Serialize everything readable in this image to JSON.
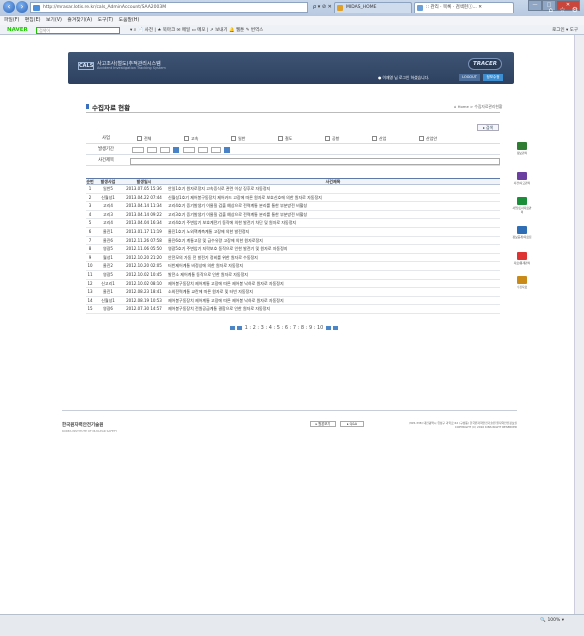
{
  "browser": {
    "url": "http://mrasar.lotis.re.kr/cals_AdminAccount/SAA2003M",
    "address_controls": "ρ ▾ ⊘ ✕",
    "tabs": [
      {
        "label": "MIDAS_HOME",
        "color": "#e0a12a"
      },
      {
        "label": ":: 관리 · 목록 · 검색현ⓘ... ✕",
        "color": "#6a9fd8"
      }
    ],
    "window_buttons": [
      "—",
      "□",
      "✕"
    ],
    "right_icons": "⌂ ☆ ⚙",
    "menu": [
      "파일(F)",
      "편집(E)",
      "보기(V)",
      "즐겨찾기(A)",
      "도구(T)",
      "도움말(H)"
    ],
    "naver_logo": "NAVER",
    "naver_search_placeholder": "검색어",
    "naver_tools": "▾  ⌕  📄 사전  |  ★ 북마크  ✉ 메일  ▭ 메모  |  ↗ 보내기  🔔 웹툰  ✎ 번역스",
    "naver_right": "로그인 ▾   도구",
    "zoom": "🔍 100%  ▾"
  },
  "header": {
    "logo": "CALS",
    "system_name": "사고조사(철도)추적관리시스템",
    "system_name_en": "Accident Investigation Tracking System",
    "brand": "TRACER",
    "welcome": "● 이재영 님 로그인 하셨습니다.",
    "logout": "LOGOUT",
    "myinfo": "정보수정"
  },
  "page": {
    "title": "수집자료 현황",
    "breadcrumb": "⌂ Home > 수집자료관리현황",
    "search_button": "▸ 검색"
  },
  "filters": {
    "category_label": "사업",
    "options": [
      "전체",
      "고속",
      "일반",
      "철도",
      "공항",
      "산업",
      "산업안"
    ],
    "period_label": "발생기간",
    "title_label": "사건제목"
  },
  "table": {
    "headers": [
      "순번",
      "발생사업",
      "발생일시",
      "사건제목"
    ],
    "rows": [
      [
        "1",
        "일반5",
        "2013.07.05 15:36",
        "안일1호기 원자로정지 고속증식로 관련 이상 징후로 자동정지"
      ],
      [
        "2",
        "신월성1",
        "2013.04.22 07:44",
        "신월성1호기 제어봉구동장치 제어카드 고장에 따른 원자로 보호신호에 의한 원자로 자동정지"
      ],
      [
        "3",
        "고리4",
        "2013.04.14 11:34",
        "고리4호기 증기발생기 이물질 검출 예상으로 전력계통 분리를 통한 부분방전 비활성"
      ],
      [
        "4",
        "고리3",
        "2013.04.14 09:22",
        "고리3호기 증기발생기 이물질 검출 예상으로 전력계통 분리를 통한 부분방전 비활성"
      ],
      [
        "5",
        "고리4",
        "2013.04.04 16:34",
        "고리4호기 주변압기 보호계전기 동작에 의한 발전기 차단 및 원자로 자동정지"
      ],
      [
        "6",
        "울진1",
        "2013.01.17 11:19",
        "울진1호기 노외핵계측계통 고장에 의한 발전정지"
      ],
      [
        "7",
        "울진6",
        "2012.11.26 07:58",
        "울진6호기 계통고장 및 급수유량 고장에 의한 원자로정지"
      ],
      [
        "8",
        "영광5",
        "2012.11.06 05:50",
        "영광5호기 주변압기 지락보호 동작으로 인한 발전기 및 원자로 자동정지"
      ],
      [
        "9",
        "월성1",
        "2012.10.20 21:20",
        "안전모의 가동 전 발전기 정비를 위한 원자로 수동정지"
      ],
      [
        "10",
        "울진2",
        "2012.10.20 02:05",
        "터빈제어계통 비정상에 의한 원자로 자동정지"
      ],
      [
        "11",
        "영광5",
        "2012.10.02 10:45",
        "발전소 제어계통 동작으로 인한 원자로 자동정지"
      ],
      [
        "12",
        "신고리1",
        "2012.10.02 08:10",
        "제어봉구동장치 제어계통 고장에 따른 제어봉 낙하로 원자로 자동정지"
      ],
      [
        "13",
        "울진1",
        "2012.08.23 18:41",
        "소외전력계통 교란에 따른 원자로 및 터빈 자동정지"
      ],
      [
        "14",
        "신월성1",
        "2012.08.19 10:53",
        "제어봉구동장치 제어계통 고장에 따른 제어봉 낙하로 원자로 자동정지"
      ],
      [
        "15",
        "영광6",
        "2012.07.30 14:57",
        "제어봉구동장치 전원공급계통 결함으로 인한 원자로 자동정지"
      ]
    ]
  },
  "pager": {
    "pages": "1 : 2 : 3 : 4 : 5 : 6 : 7 : 8 : 9 : 10"
  },
  "footer": {
    "org": "한국원자력안전기술원",
    "org_en": "KOREA INSTITUTE OF NUCLEAR SAFETY",
    "btn1": "▸ 원본보기",
    "btn2": "▸ Q&A",
    "address": "(305-338) 대전광역시 유성구 과학로 62 (구성동) 한국원자력안전기술원 원자력안전정보실",
    "copyright": "COPYRIGHT (C) 2010 KINS RIGHT RESERVED"
  },
  "quickmenu": [
    {
      "label": "정보관리",
      "color": "#2e7d32"
    },
    {
      "label": "사건/사고관리",
      "color": "#6a3fa0"
    },
    {
      "label": "사업/조사자료관리",
      "color": "#1b8e3a"
    },
    {
      "label": "정보공개/자료집",
      "color": "#2f6db5"
    },
    {
      "label": "자료/통계관리",
      "color": "#d33"
    },
    {
      "label": "수집자료",
      "color": "#c98a1a"
    }
  ]
}
